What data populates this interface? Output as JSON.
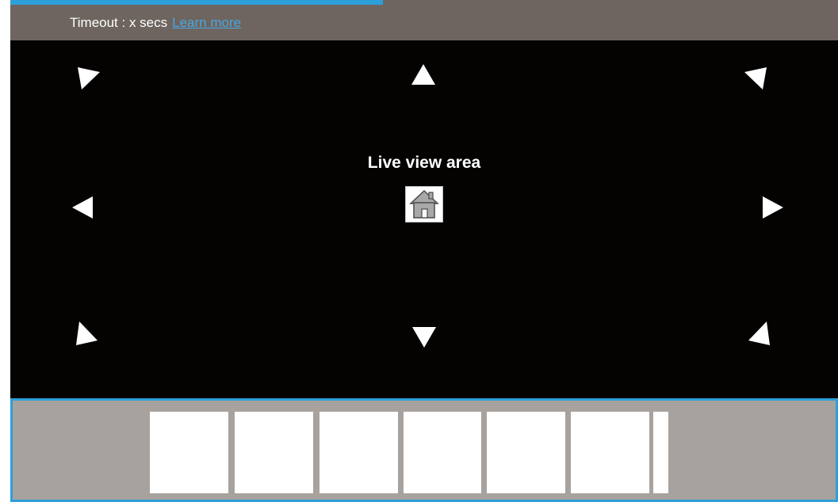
{
  "header": {
    "timeout_text": "Timeout : x secs",
    "learn_more_label": "Learn more"
  },
  "timeout_progress_percent": 45,
  "live_view": {
    "title": "Live view area",
    "home_button_icon": "house-icon",
    "pan_controls": [
      {
        "direction": "up-left",
        "icon": "arrow-up-left-icon"
      },
      {
        "direction": "up",
        "icon": "arrow-up-icon"
      },
      {
        "direction": "up-right",
        "icon": "arrow-up-right-icon"
      },
      {
        "direction": "left",
        "icon": "arrow-left-icon"
      },
      {
        "direction": "right",
        "icon": "arrow-right-icon"
      },
      {
        "direction": "down-left",
        "icon": "arrow-down-left-icon"
      },
      {
        "direction": "down",
        "icon": "arrow-down-icon"
      },
      {
        "direction": "down-right",
        "icon": "arrow-down-right-icon"
      }
    ]
  },
  "thumbnail_strip": {
    "thumbnails": 7
  },
  "colors": {
    "accent": "#2d9fd9",
    "header_bg": "#6e6560",
    "live_view_bg": "#050202",
    "strip_bg": "#a8a29e",
    "link": "#4aa6e0"
  }
}
